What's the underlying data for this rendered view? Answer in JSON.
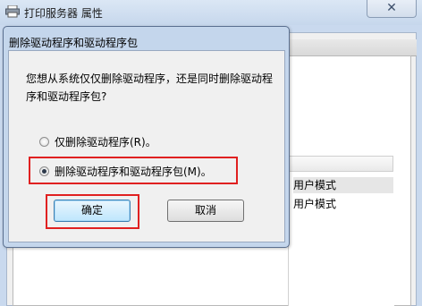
{
  "parent_window": {
    "title": "打印服务器 属性",
    "close_glyph": "✕",
    "list_rows": [
      "用户模式",
      "用户模式"
    ]
  },
  "dialog": {
    "title": "删除驱动程序和驱动程序包",
    "message": "您想从系统仅仅删除驱动程序，还是同时删除驱动程序和驱动程序包?",
    "options": [
      {
        "label": "仅删除驱动程序(R)。",
        "checked": false
      },
      {
        "label": "删除驱动程序和驱动程序包(M)。",
        "checked": true
      }
    ],
    "ok_label": "确定",
    "cancel_label": "取消"
  },
  "colors": {
    "highlight": "#e02020",
    "title_bar": "#c4d6ec",
    "ok_accent": "#3c7fb1"
  },
  "icons": {
    "title_icon": "printer-icon",
    "close_icon": "close-icon"
  }
}
